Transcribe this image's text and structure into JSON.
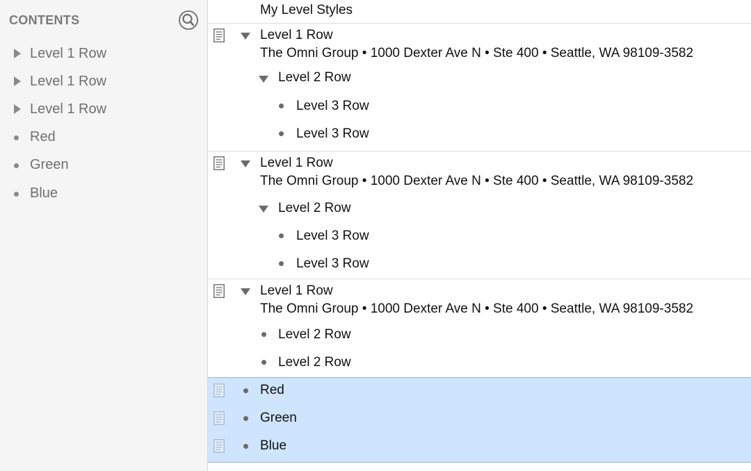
{
  "sidebar": {
    "title": "CONTENTS",
    "search_icon": "magnifier-icon",
    "items": [
      {
        "label": "Level 1 Row",
        "kind": "collapsed"
      },
      {
        "label": "Level 1 Row",
        "kind": "collapsed"
      },
      {
        "label": "Level 1 Row",
        "kind": "collapsed"
      },
      {
        "label": "Red",
        "kind": "bullet"
      },
      {
        "label": "Green",
        "kind": "bullet"
      },
      {
        "label": "Blue",
        "kind": "bullet"
      }
    ]
  },
  "outline": {
    "column_title": "My Level Styles",
    "groups": [
      {
        "level1": "Level 1 Row",
        "note": "The Omni Group • 1000 Dexter Ave N • Ste 400 • Seattle, WA 98109-3582",
        "level2": "Level 2 Row",
        "level3": [
          "Level 3 Row",
          "Level 3 Row"
        ]
      },
      {
        "level1": "Level 1 Row",
        "note": "The Omni Group • 1000 Dexter Ave N • Ste 400 • Seattle, WA 98109-3582",
        "level2": "Level 2 Row",
        "level3": [
          "Level 3 Row",
          "Level 3 Row"
        ]
      },
      {
        "level1": "Level 1 Row",
        "note": "The Omni Group • 1000 Dexter Ave N • Ste 400 • Seattle, WA 98109-3582",
        "level2_items": [
          "Level 2 Row",
          "Level 2 Row"
        ]
      }
    ],
    "selected_rows": [
      "Red",
      "Green",
      "Blue"
    ]
  },
  "colors": {
    "selection": "#cfe4fd",
    "sidebar_bg": "#f5f5f5"
  }
}
